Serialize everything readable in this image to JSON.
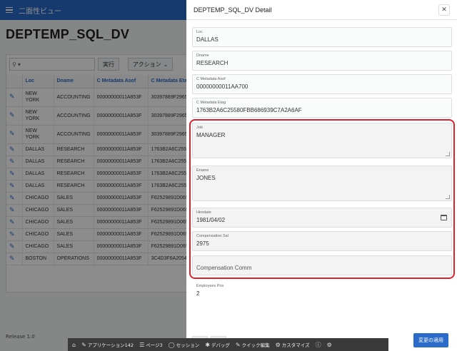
{
  "app": {
    "title": "二面性ビュー",
    "page_title": "DEPTEMP_SQL_DV",
    "release": "Release 1.0"
  },
  "report": {
    "go_label": "実行",
    "actions_label": "アクション",
    "columns": [
      "Loc",
      "Dname",
      "C Metadata Asof",
      "C Metadata Etag"
    ],
    "rows": [
      [
        "NEW YORK",
        "ACCOUNTING",
        "00000000011A853F",
        "30397889F29653"
      ],
      [
        "NEW YORK",
        "ACCOUNTING",
        "00000000011A853F",
        "30397889F29653"
      ],
      [
        "NEW YORK",
        "ACCOUNTING",
        "00000000011A853F",
        "30397889F29653"
      ],
      [
        "DALLAS",
        "RESEARCH",
        "00000000011A853F",
        "1763B2A6C25580"
      ],
      [
        "DALLAS",
        "RESEARCH",
        "00000000011A853F",
        "1763B2A6C25580"
      ],
      [
        "DALLAS",
        "RESEARCH",
        "00000000011A853F",
        "1763B2A6C25580"
      ],
      [
        "DALLAS",
        "RESEARCH",
        "00000000011A853F",
        "1763B2A6C25580"
      ],
      [
        "CHICAGO",
        "SALES",
        "00000000011A853F",
        "F62529891D065E"
      ],
      [
        "CHICAGO",
        "SALES",
        "00000000011A853F",
        "F62529891D065E"
      ],
      [
        "CHICAGO",
        "SALES",
        "00000000011A853F",
        "F62529891D065E"
      ],
      [
        "CHICAGO",
        "SALES",
        "00000000011A853F",
        "F62529891D065E"
      ],
      [
        "CHICAGO",
        "SALES",
        "00000000011A853F",
        "F62529891D065E"
      ],
      [
        "BOSTON",
        "OPERATIONS",
        "00000000011A853F",
        "3C4D3F6A20547"
      ]
    ]
  },
  "dialog": {
    "title": "DEPTEMP_SQL_DV Detail",
    "fields": {
      "loc": {
        "label": "Loc",
        "value": "DALLAS"
      },
      "dname": {
        "label": "Dname",
        "value": "RESEARCH"
      },
      "asof": {
        "label": "C Metadata Asof",
        "value": "00000000011AA700"
      },
      "etag": {
        "label": "C Metadata Etag",
        "value": "1763B2A6C25580FBB686939C7A2A6AF"
      },
      "job": {
        "label": "Job",
        "value": "MANAGER"
      },
      "ename": {
        "label": "Ename",
        "value": "JONES"
      },
      "hiredate": {
        "label": "Hiredate",
        "value": "1981/04/02"
      },
      "sal": {
        "label": "Compensation Sal",
        "value": "2975"
      },
      "comm": {
        "label": "Compensation Comm"
      },
      "pos": {
        "label": "Employees Pos",
        "value": "2"
      }
    },
    "apply_label": "変更の適用",
    "highlight_color": "#e0202a"
  },
  "devbar": {
    "items": [
      {
        "icon": "home-icon",
        "label": ""
      },
      {
        "icon": "edit-icon",
        "label": "アプリケーション142"
      },
      {
        "icon": "page-icon",
        "label": "ページ3"
      },
      {
        "icon": "session-icon",
        "label": "セッション"
      },
      {
        "icon": "debug-icon",
        "label": "デバッグ"
      },
      {
        "icon": "quick-edit-icon",
        "label": "クイック編集"
      },
      {
        "icon": "customize-icon",
        "label": "カスタマイズ"
      },
      {
        "icon": "info-icon",
        "label": ""
      },
      {
        "icon": "settings-icon",
        "label": ""
      }
    ]
  },
  "colors": {
    "header_blue": "#2b6bc9",
    "highlight_red": "#e0202a",
    "devbar_bg": "#3a3a3a"
  }
}
